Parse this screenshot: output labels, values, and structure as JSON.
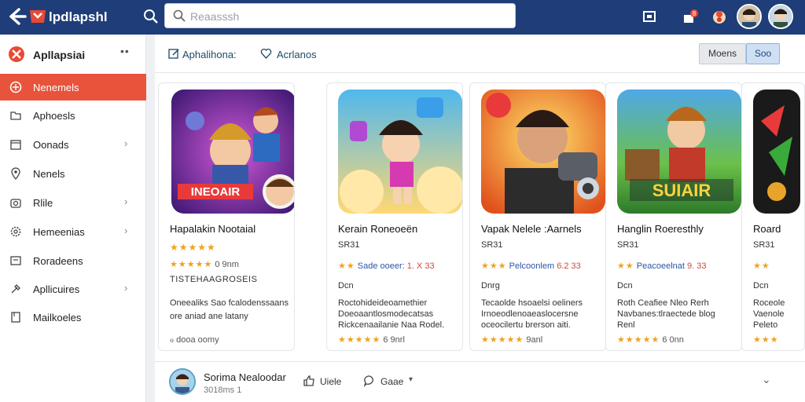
{
  "topbar": {
    "app_title": "lpdlapshl",
    "search_placeholder": "Reaasssh",
    "notification_badge": "8"
  },
  "sidebar": {
    "brand": "Apllapsiai",
    "more": "••",
    "items": [
      {
        "label": "Nenemels",
        "icon": "target-icon",
        "active": true,
        "chevron": false
      },
      {
        "label": "Aphoesls",
        "icon": "folder-icon",
        "active": false,
        "chevron": false
      },
      {
        "label": "Oonads",
        "icon": "calendar-icon",
        "active": false,
        "chevron": true
      },
      {
        "label": "Nenels",
        "icon": "location-icon",
        "active": false,
        "chevron": false
      },
      {
        "label": "Rlile",
        "icon": "camera-icon",
        "active": false,
        "chevron": true
      },
      {
        "label": "Hemeenias",
        "icon": "gear-icon",
        "active": false,
        "chevron": true
      },
      {
        "label": "Roradeens",
        "icon": "tag-icon",
        "active": false,
        "chevron": false
      },
      {
        "label": "Apllicuires",
        "icon": "settings-icon",
        "active": false,
        "chevron": true
      },
      {
        "label": "Mailkoeles",
        "icon": "bookmark-icon",
        "active": false,
        "chevron": false
      }
    ]
  },
  "main": {
    "tab1": "Aphalihona:",
    "tab2": "Acrlanos",
    "btn_mens": "Moens",
    "btn_soo": "Soo",
    "cards": [
      {
        "title": "Hapalakin Nootaial",
        "art_text": "INEOAIR",
        "stars": "★★★★★",
        "rr_stars": "★★★★★",
        "rr_pub": "",
        "rr_num": "0 9nm",
        "lines": [
          "TISTEHAAGROSEIS",
          "Oneealiks Sao fcalodenssaans",
          "ore aniad ane latany"
        ],
        "bottom": "ℴ dooa   oomy",
        "bottom_stars": ""
      },
      {
        "title": "Kerain Roneoeën",
        "art_text": "",
        "stars": "",
        "rr_stars": "★★",
        "rr_pub": "Sade ooeer:",
        "rr_num": "1. X 33",
        "lines": [
          "SR31",
          "Dcn",
          "Roctohideideoamethier",
          "Doeoaantlosmodecatsas",
          "Rickcenaailanie Naa Rodel."
        ],
        "bottom": "6 9nrl",
        "bottom_stars": "★★★★★"
      },
      {
        "title": "Vapak Nelele :Aarnels",
        "art_text": "",
        "stars": "",
        "rr_stars": "★★★",
        "rr_pub": "Pelcoonlem",
        "rr_num": "6.2 33",
        "lines": [
          "SR31",
          "Dnrg",
          "Tecaolde hsoaelsi oeliners",
          "Irnoeodlenoaeaslocersne",
          "oceocilertu brerson aiti."
        ],
        "bottom": "9anl",
        "bottom_stars": "★★★★★"
      },
      {
        "title": "Hanglin Roeresthly",
        "art_text": "SUIAIR",
        "stars": "",
        "rr_stars": "★★",
        "rr_pub": "Peacoeelnat",
        "rr_num": "9. 33",
        "lines": [
          "SR31",
          "Dcn",
          "Roth Ceafiee Nleo Rerh",
          "Navbanes:tlraectede blog",
          "Renl"
        ],
        "bottom": "6 0nn",
        "bottom_stars": "★★★★★"
      },
      {
        "title": "Roard",
        "art_text": "",
        "stars": "",
        "rr_stars": "★★",
        "rr_pub": "",
        "rr_num": "",
        "lines": [
          "SR31",
          "Dcn",
          "Roceole",
          "Vaenole",
          "Peleto"
        ],
        "bottom": "",
        "bottom_stars": "★★★"
      }
    ]
  },
  "footer": {
    "name": "Sorima Nealoodar",
    "sub": "3018ms 1",
    "like": "Uiele",
    "comment": "Gaae"
  },
  "colors": {
    "topbar": "#1f3d78",
    "active": "#e8533c",
    "star": "#f0a21a",
    "publisher": "#2d55a6"
  }
}
